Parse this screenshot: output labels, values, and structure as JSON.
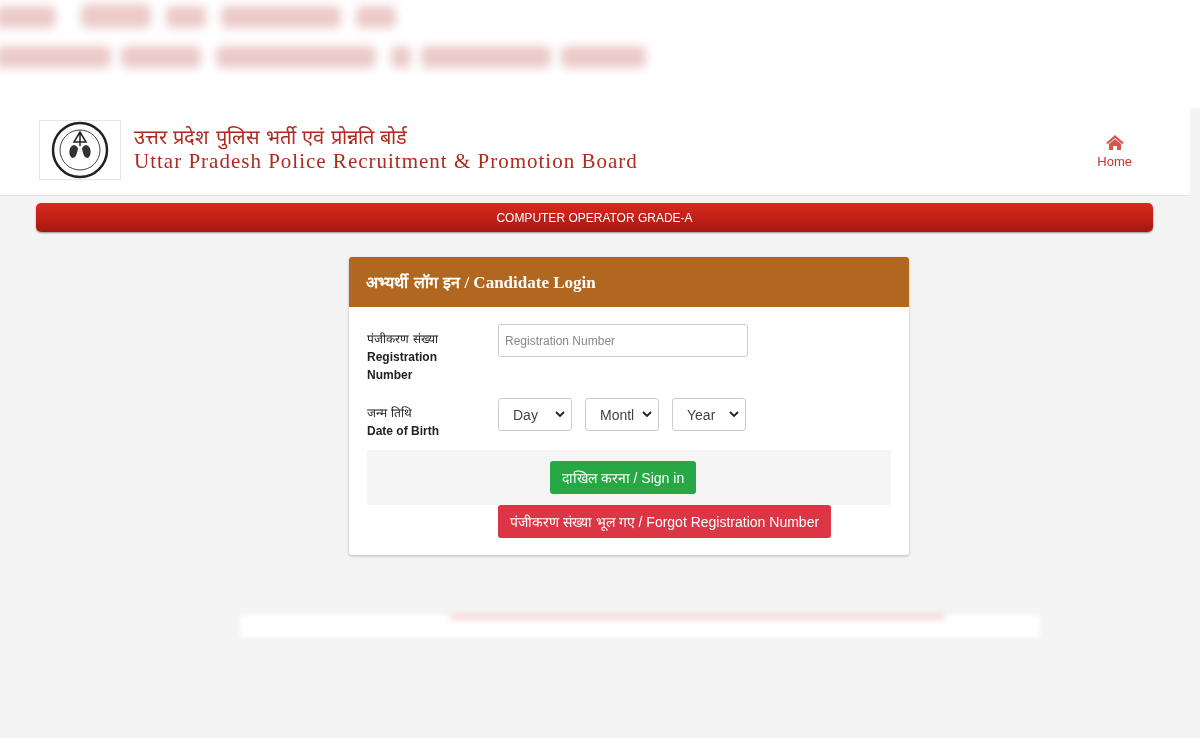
{
  "header": {
    "title_hindi": "उत्तर प्रदेश पुलिस भर्ती एवं प्रोन्नति बोर्ड",
    "title_english": "Uttar Pradesh Police Recruitment & Promotion Board",
    "nav": [
      {
        "label": "Home"
      }
    ]
  },
  "banner": "COMPUTER OPERATOR GRADE-A",
  "login": {
    "title_hindi": "अभ्यर्थी लॉग इन",
    "title_english": "/ Candidate Login",
    "fields": [
      {
        "kind": "text",
        "label_hindi": "पंजीकरण संख्या",
        "label_english": "Registration Number",
        "placeholder": "Registration Number"
      },
      {
        "kind": "date",
        "label_hindi": "जन्म तिथि",
        "label_english": "Date of Birth",
        "selects": [
          "Day",
          "Montl",
          "Year"
        ]
      }
    ],
    "sign_in": "दाखिल करना / Sign in",
    "forgot": "पंजीकरण संख्या भूल गए / Forgot Registration Number"
  }
}
